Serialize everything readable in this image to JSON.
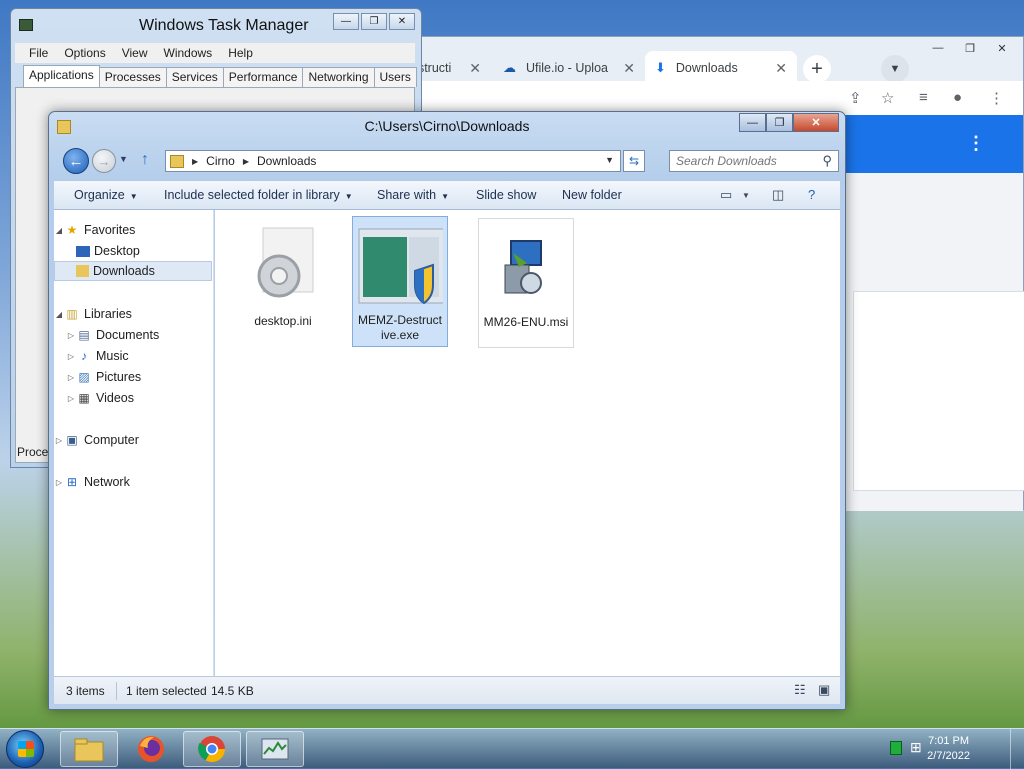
{
  "chrome": {
    "tabs": [
      {
        "label": "estructi",
        "icon": "page-icon"
      },
      {
        "label": "Ufile.io - Uploa",
        "icon": "ufile-icon"
      },
      {
        "label": "Downloads",
        "icon": "download-arrow-icon",
        "active": true
      }
    ],
    "new_tab": "+",
    "accent": "#1a73e8"
  },
  "taskmgr": {
    "title": "Windows Task Manager",
    "menu": [
      "File",
      "Options",
      "View",
      "Windows",
      "Help"
    ],
    "tabs": [
      "Applications",
      "Processes",
      "Services",
      "Performance",
      "Networking",
      "Users"
    ],
    "active_tab": "Applications",
    "fragment": "Proce"
  },
  "explorer": {
    "title": "C:\\Users\\Cirno\\Downloads",
    "breadcrumb": [
      "Cirno",
      "Downloads"
    ],
    "search_placeholder": "Search Downloads",
    "commands": {
      "organize": "Organize",
      "include": "Include selected folder in library",
      "share": "Share with",
      "slideshow": "Slide show",
      "newfolder": "New folder"
    },
    "nav": {
      "favorites": "Favorites",
      "desktop": "Desktop",
      "downloads": "Downloads",
      "libraries": "Libraries",
      "documents": "Documents",
      "music": "Music",
      "pictures": "Pictures",
      "videos": "Videos",
      "computer": "Computer",
      "network": "Network"
    },
    "files": [
      {
        "name": "desktop.ini",
        "icon": "settings-file-icon"
      },
      {
        "name": "MEMZ-Destructive.exe",
        "icon": "exe-uac-icon",
        "selected": true
      },
      {
        "name": "MM26-ENU.msi",
        "icon": "msi-installer-icon"
      }
    ],
    "status": {
      "count": "3 items",
      "selected": "1 item selected",
      "size": "14.5 KB"
    }
  },
  "taskbar": {
    "time": "7:01 PM",
    "date": "2/7/2022"
  }
}
